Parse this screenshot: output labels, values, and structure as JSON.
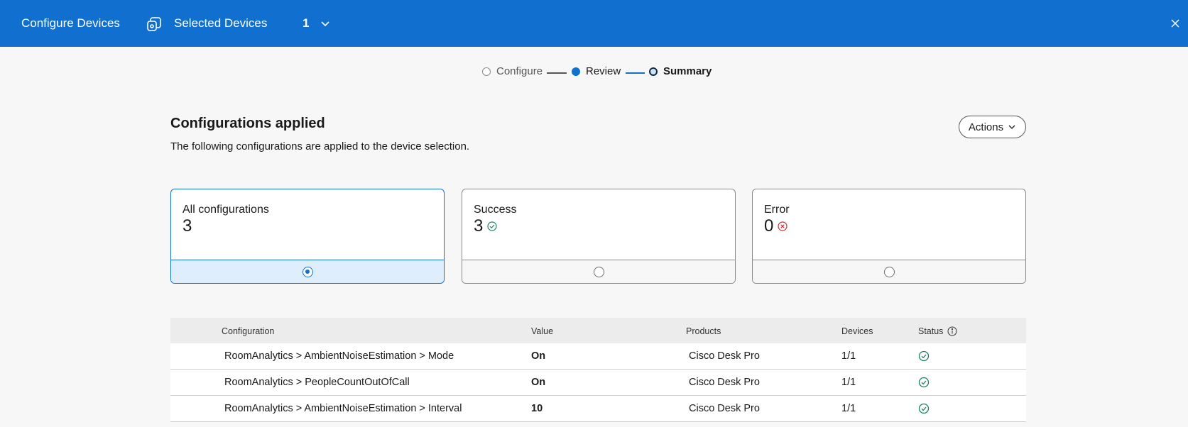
{
  "header": {
    "title": "Configure Devices",
    "selected_label": "Selected Devices",
    "selected_count": "1",
    "brand_color": "#1170cf"
  },
  "stepper": {
    "steps": [
      {
        "label": "Configure",
        "state": "done"
      },
      {
        "label": "Review",
        "state": "done"
      },
      {
        "label": "Summary",
        "state": "current"
      }
    ]
  },
  "main": {
    "title": "Configurations applied",
    "subtitle": "The following configurations are applied to the device selection.",
    "actions_label": "Actions"
  },
  "cards": [
    {
      "label": "All configurations",
      "value": "3",
      "selected": true
    },
    {
      "label": "Success",
      "value": "3",
      "icon": "check-circle-icon",
      "color": "#1d805f"
    },
    {
      "label": "Error",
      "value": "0",
      "icon": "x-circle-icon",
      "color": "#d4263c"
    }
  ],
  "table": {
    "headers": [
      "Configuration",
      "Value",
      "Products",
      "Devices",
      "Status"
    ],
    "rows": [
      {
        "configuration": "RoomAnalytics > AmbientNoiseEstimation > Mode",
        "value": "On",
        "product": "Cisco Desk Pro",
        "devices": "1/1",
        "status": "success"
      },
      {
        "configuration": "RoomAnalytics > PeopleCountOutOfCall",
        "value": "On",
        "product": "Cisco Desk Pro",
        "devices": "1/1",
        "status": "success"
      },
      {
        "configuration": "RoomAnalytics > AmbientNoiseEstimation > Interval",
        "value": "10",
        "product": "Cisco Desk Pro",
        "devices": "1/1",
        "status": "success"
      }
    ]
  }
}
